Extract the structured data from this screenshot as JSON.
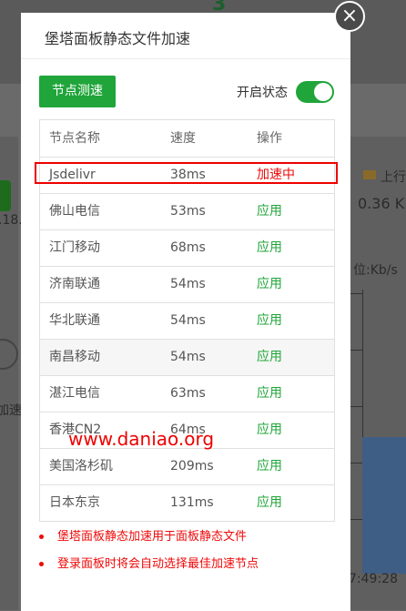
{
  "background": {
    "top_number": "3",
    "left_text_1": ".18.",
    "left_text_2": "加速",
    "right_legend": "上行",
    "right_speed": "0.36 K",
    "right_unit": "位:Kb/s",
    "right_time": "7:49:28"
  },
  "dialog": {
    "title": "堡塔面板静态文件加速",
    "close_icon": "×",
    "test_button": "节点测速",
    "toggle_label": "开启状态",
    "toggle_on": true,
    "accent_color": "#20a53a",
    "alert_color": "#ef0808"
  },
  "table": {
    "headers": [
      "节点名称",
      "速度",
      "操作"
    ],
    "rows": [
      {
        "name": "Jsdelivr",
        "speed": "38ms",
        "action": "加速中"
      },
      {
        "name": "佛山电信",
        "speed": "53ms",
        "action": "应用"
      },
      {
        "name": "江门移动",
        "speed": "68ms",
        "action": "应用"
      },
      {
        "name": "济南联通",
        "speed": "54ms",
        "action": "应用"
      },
      {
        "name": "华北联通",
        "speed": "54ms",
        "action": "应用"
      },
      {
        "name": "南昌移动",
        "speed": "54ms",
        "action": "应用"
      },
      {
        "name": "湛江电信",
        "speed": "63ms",
        "action": "应用"
      },
      {
        "name": "香港CN2",
        "speed": "64ms",
        "action": "应用"
      },
      {
        "name": "美国洛杉矶",
        "speed": "209ms",
        "action": "应用"
      },
      {
        "name": "日本东京",
        "speed": "131ms",
        "action": "应用"
      }
    ]
  },
  "watermark": "www.daniao.org",
  "notes": [
    "堡塔面板静态加速用于面板静态文件",
    "登录面板时将会自动选择最佳加速节点"
  ]
}
